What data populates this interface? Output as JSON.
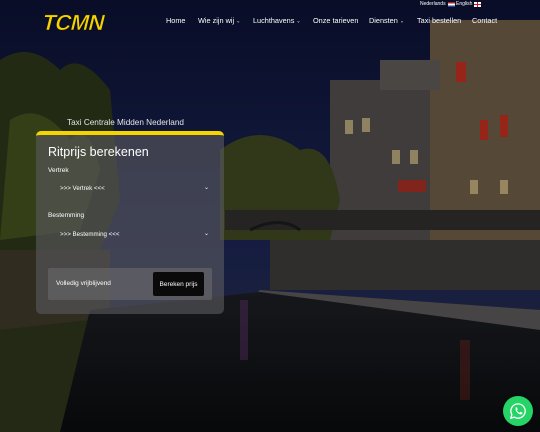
{
  "brand": {
    "logo_text": "TCMN",
    "logo_color": "#f5d400"
  },
  "languages": [
    {
      "label": "Nederlands",
      "flag": "flag-nl"
    },
    {
      "label": "English",
      "flag": "flag-en"
    }
  ],
  "nav": {
    "items": [
      {
        "label": "Home",
        "dropdown": false
      },
      {
        "label": "Wie zijn wij",
        "dropdown": true
      },
      {
        "label": "Luchthavens",
        "dropdown": true
      },
      {
        "label": "Onze tarieven",
        "dropdown": false
      },
      {
        "label": "Diensten",
        "dropdown": true
      },
      {
        "label": "Taxi bestellen",
        "dropdown": false
      },
      {
        "label": "Contact",
        "dropdown": false
      }
    ]
  },
  "hero": {
    "tagline": "Taxi Centrale Midden Nederland"
  },
  "calculator": {
    "title": "Ritprijs berekenen",
    "from_label": "Vertrek",
    "from_value": ">>> Vertrek <<<",
    "to_label": "Bestemming",
    "to_value": ">>> Bestemming <<<",
    "notice": "Volledig vrijblijvend",
    "button": "Bereken prijs",
    "accent_color": "#f5d400"
  },
  "whatsapp": {
    "icon": "whatsapp-icon",
    "color": "#25d366"
  }
}
